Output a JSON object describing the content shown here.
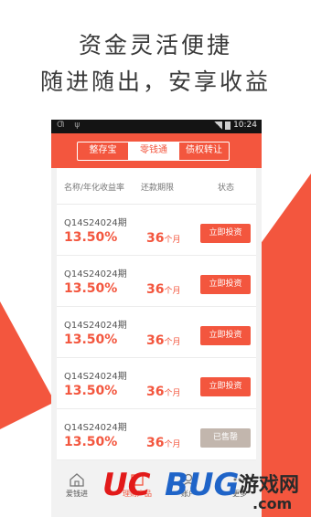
{
  "promo": {
    "line1": "资金灵活便捷",
    "line2": "随进随出，安享收益"
  },
  "colors": {
    "accent": "#f3563e",
    "soldout": "#c2b6ad"
  },
  "statusbar": {
    "left_icons": "Ƣ ψ",
    "time": "10:24"
  },
  "tabs": [
    {
      "label": "整存宝",
      "active": false
    },
    {
      "label": "零钱通",
      "active": true
    },
    {
      "label": "债权转让",
      "active": false
    }
  ],
  "table": {
    "headers": [
      "名称/年化收益率",
      "还款期限",
      "状态"
    ],
    "rows": [
      {
        "name": "Q14S24024期",
        "rate": "13.50%",
        "term": "36",
        "unit": "个月",
        "status": "立即投资"
      },
      {
        "name": "Q14S24024期",
        "rate": "13.50%",
        "term": "36",
        "unit": "个月",
        "status": "立即投资"
      },
      {
        "name": "Q14S24024期",
        "rate": "13.50%",
        "term": "36",
        "unit": "个月",
        "status": "立即投资"
      },
      {
        "name": "Q14S24024期",
        "rate": "13.50%",
        "term": "36",
        "unit": "个月",
        "status": "立即投资"
      },
      {
        "name": "Q14S24024期",
        "rate": "13.50%",
        "term": "36",
        "unit": "个月",
        "status": "已售罄"
      }
    ]
  },
  "nav": [
    {
      "label": "爱钱进",
      "icon": "home-icon"
    },
    {
      "label": "理财产品",
      "icon": "product-icon"
    },
    {
      "label": "账户",
      "icon": "account-icon"
    },
    {
      "label": "更多",
      "icon": "more-icon"
    }
  ],
  "watermark": {
    "uc": "UC",
    "bug": "BUG",
    "cn": "游戏网",
    "com": ".com"
  }
}
